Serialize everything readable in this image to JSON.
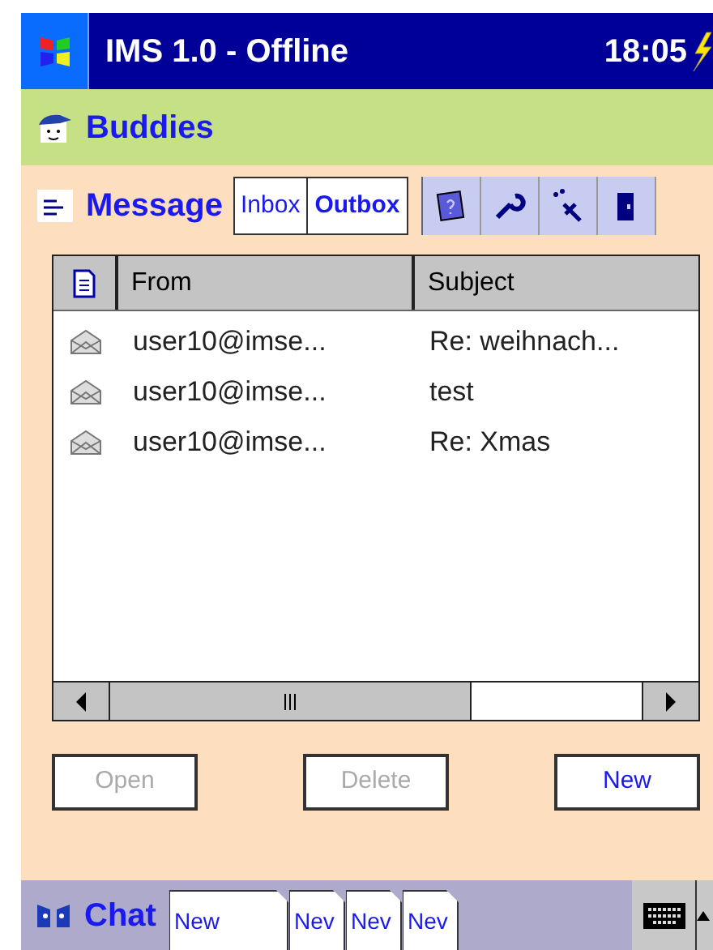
{
  "window": {
    "title": "IMS 1.0 - Offline",
    "time": "18:05"
  },
  "buddies": {
    "label": "Buddies"
  },
  "message": {
    "label": "Message",
    "tabs": [
      {
        "label": "Inbox",
        "selected": false
      },
      {
        "label": "Outbox",
        "selected": true
      }
    ]
  },
  "table": {
    "columns": [
      "From",
      "Subject"
    ],
    "rows": [
      {
        "from": "user10@imse...",
        "subject": "Re: weihnach..."
      },
      {
        "from": "user10@imse...",
        "subject": "test"
      },
      {
        "from": "user10@imse...",
        "subject": "Re: Xmas"
      }
    ]
  },
  "buttons": [
    {
      "label": "Open",
      "disabled": true
    },
    {
      "label": "Delete",
      "disabled": true
    },
    {
      "label": "New",
      "disabled": false
    }
  ],
  "chat": {
    "label": "Chat",
    "tabs": [
      {
        "label": "New"
      },
      {
        "label": "Nev"
      },
      {
        "label": "Nev"
      },
      {
        "label": "Nev"
      }
    ]
  }
}
